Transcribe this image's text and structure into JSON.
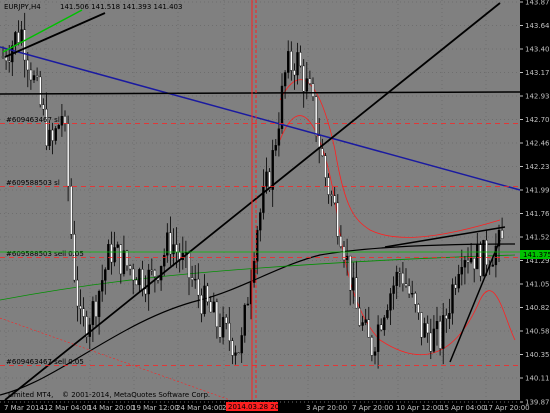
{
  "window": {
    "symbol_timeframe": "EURJPY,H4",
    "ohlc": "141.506 141.518 141.393 141.403"
  },
  "copyright": "© 2001-2014, MetaQuotes Software Corp.",
  "copyright_prefix": "Limited MT4,",
  "chart_data": {
    "type": "candlestick",
    "symbol": "EURJPY",
    "timeframe": "H4",
    "ylim": [
      139.875,
      143.875
    ],
    "price_ticks": [
      "143.875",
      "143.640",
      "143.405",
      "143.170",
      "142.935",
      "142.700",
      "142.465",
      "142.230",
      "141.995",
      "141.760",
      "141.525",
      "141.290",
      "141.055",
      "140.820",
      "140.585",
      "140.350",
      "140.115",
      "139.875"
    ],
    "time_ticks": [
      "7 Mar 2014",
      "12 Mar 04:00",
      "14 Mar 20:00",
      "19 Mar 12:00",
      "24 Mar 04:00",
      "26 Mar 20:00",
      "2014.03.28 20:00",
      "3 Apr 20:00",
      "7 Apr 20:00",
      "10 Apr 12:00",
      "15 Apr 04:00",
      "17 Apr 20:00"
    ],
    "current_price_label": "141.375",
    "current_price": 141.375,
    "highlight_time": "2014.03.28 20:00",
    "order_labels": [
      {
        "text": "#609463467 sl",
        "price": 142.66
      },
      {
        "text": "#609588503 sl",
        "price": 142.03
      },
      {
        "text": "#609588503 sell 0.05",
        "price": 141.32
      },
      {
        "text": "#609463467 sell 0.05",
        "price": 140.24
      }
    ],
    "grid": true
  },
  "colors": {
    "background": "#000000",
    "axis_text": "#c0c0c0",
    "candle": "#c0c0c0",
    "blue_line": "#1a1aa0",
    "black_line": "#000000",
    "red_line": "#ff2020",
    "green_line": "#00c000",
    "price_label_bg": "#00c000"
  }
}
